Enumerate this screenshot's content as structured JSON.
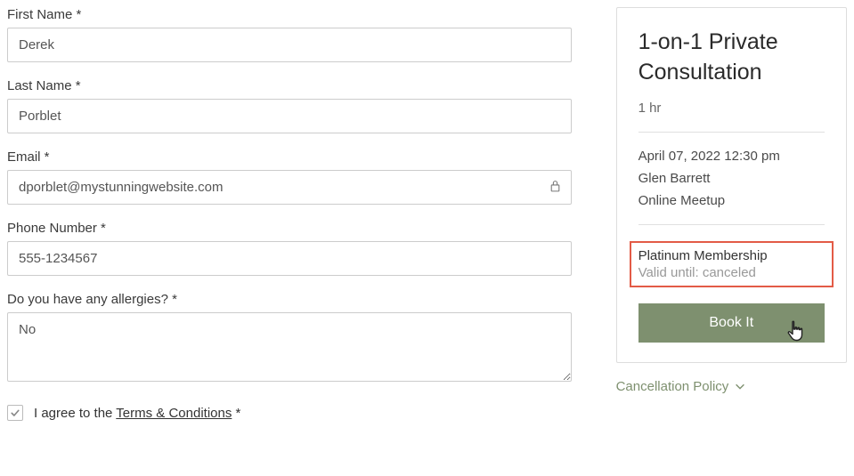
{
  "form": {
    "first_name": {
      "label": "First Name *",
      "value": "Derek"
    },
    "last_name": {
      "label": "Last Name *",
      "value": "Porblet"
    },
    "email": {
      "label": "Email *",
      "value": "dporblet@mystunningwebsite.com"
    },
    "phone": {
      "label": "Phone Number *",
      "value": "555-1234567"
    },
    "allergies": {
      "label": "Do you have any allergies? *",
      "value": "No"
    },
    "agree_prefix": "I agree to the ",
    "terms_label": "Terms & Conditions",
    "agree_suffix": " *"
  },
  "sidebar": {
    "title": "1-on-1 Private Consultation",
    "duration": "1 hr",
    "datetime": "April 07, 2022 12:30 pm",
    "staff": "Glen Barrett",
    "location": "Online Meetup",
    "membership_name": "Platinum Membership",
    "membership_valid": "Valid until: canceled",
    "book_label": "Book It",
    "cancellation_label": "Cancellation Policy"
  }
}
